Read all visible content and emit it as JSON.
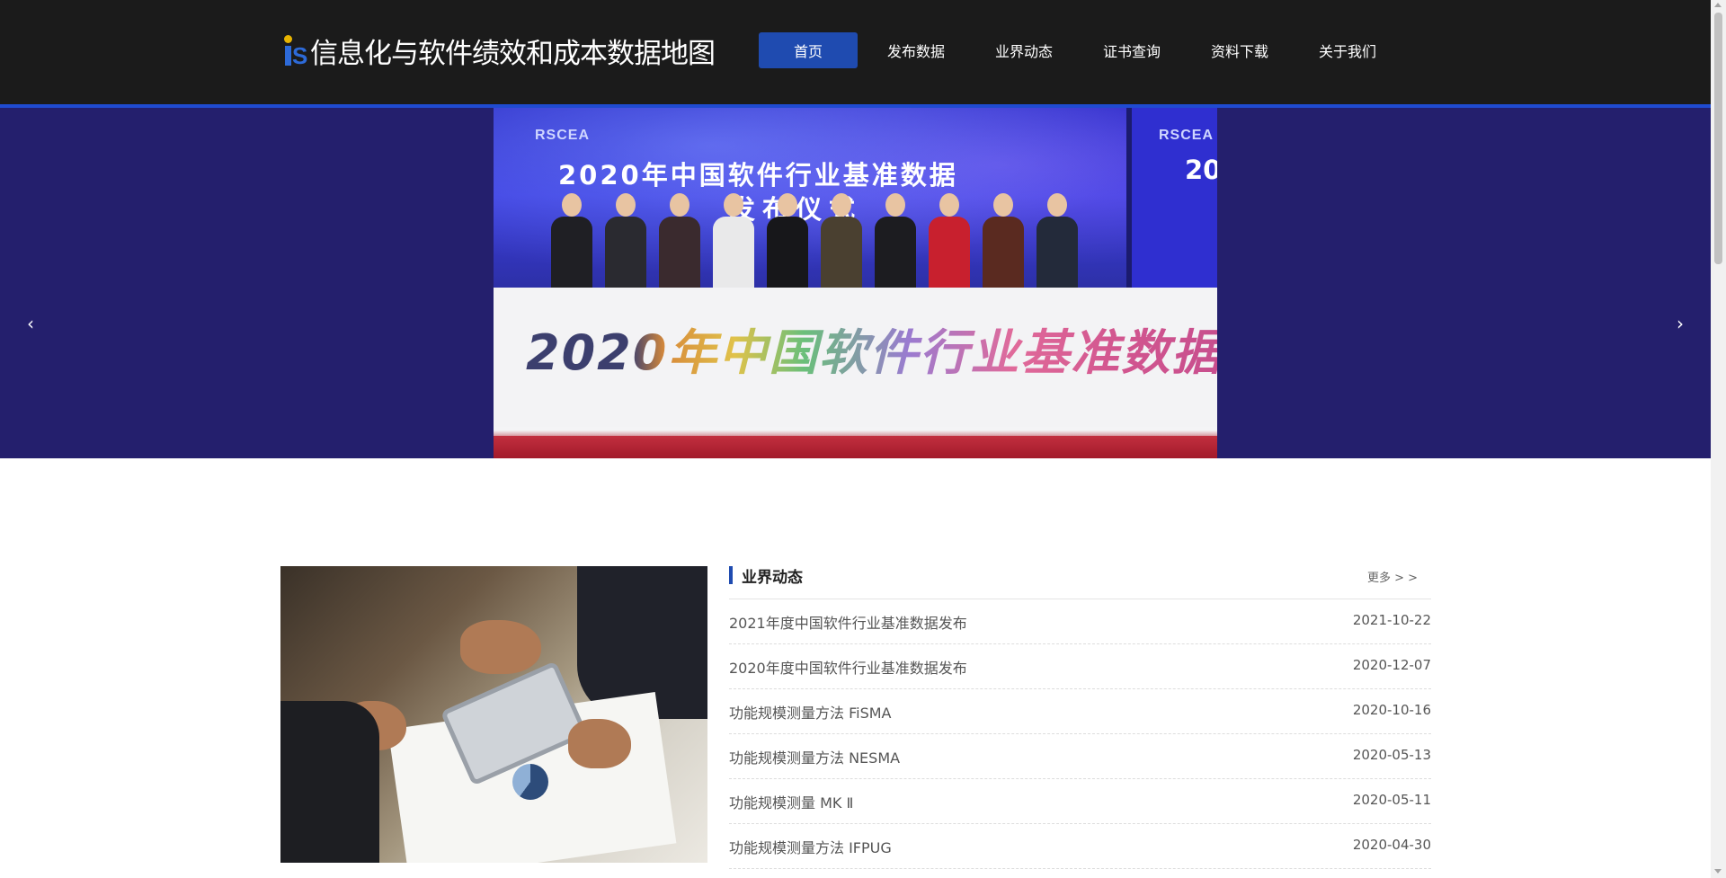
{
  "header": {
    "site_title": "信息化与软件绩效和成本数据地图",
    "logo_icon": "is-logo-icon",
    "nav": [
      {
        "label": "首页",
        "active": true
      },
      {
        "label": "发布数据",
        "active": false
      },
      {
        "label": "业界动态",
        "active": false
      },
      {
        "label": "证书查询",
        "active": false
      },
      {
        "label": "资料下载",
        "active": false
      },
      {
        "label": "关于我们",
        "active": false
      }
    ],
    "background_color": "#1b1b1b",
    "accent_color": "#1f4bb0"
  },
  "banner": {
    "background_color": "#241f6d",
    "slide": {
      "brand": "RSCEA",
      "title_line1": "2020年中国软件行业基准数据",
      "title_line2": "发布仪式",
      "title_right_partial": "20",
      "stage_text": "2020年中国软件行业基准数据"
    },
    "prev_icon": "chevron-left-icon",
    "next_icon": "chevron-right-icon",
    "prev_glyph": "‹",
    "next_glyph": "›"
  },
  "news": {
    "section_title": "业界动态",
    "more_label": "更多 > >",
    "items": [
      {
        "title": "2021年度中国软件行业基准数据发布",
        "date": "2021-10-22"
      },
      {
        "title": "2020年度中国软件行业基准数据发布",
        "date": "2020-12-07"
      },
      {
        "title": "功能规模测量方法 FiSMA",
        "date": "2020-10-16"
      },
      {
        "title": "功能规模测量方法 NESMA",
        "date": "2020-05-13"
      },
      {
        "title": "功能规模测量 MK Ⅱ",
        "date": "2020-05-11"
      },
      {
        "title": "功能规模测量方法 IFPUG",
        "date": "2020-04-30"
      }
    ]
  }
}
